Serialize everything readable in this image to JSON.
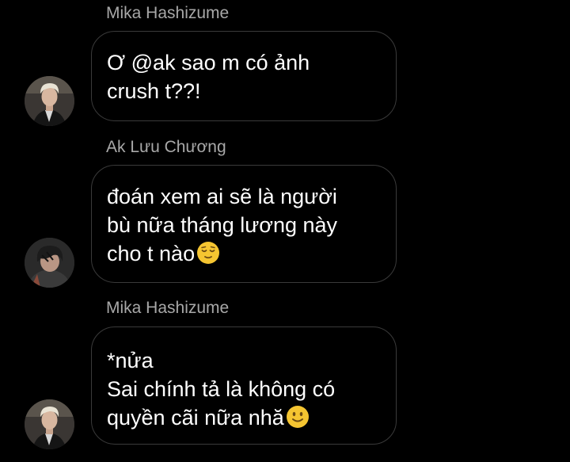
{
  "colors": {
    "background": "#000000",
    "sender_name": "#a8a8a8",
    "bubble_border": "#3a3a3a",
    "message_text": "#ffffff",
    "emoji_yellow": "#f5c531"
  },
  "messages": [
    {
      "sender": "Mika Hashizume",
      "text": "Ơ @ak sao m có ảnh\ncrush t??!",
      "emoji": "",
      "avatar_icon": "blonde-man-avatar-icon"
    },
    {
      "sender": "Ak Lưu Chương",
      "text": "đoán xem ai sẽ là người\nbù nữa tháng lương này\ncho t nào",
      "emoji": "relieved-face-emoji",
      "avatar_icon": "dark-hair-man-avatar-icon"
    },
    {
      "sender": "Mika Hashizume",
      "text": "*nửa\nSai chính tả là không có\nquyền cãi nữa nhă",
      "emoji": "slightly-smiling-face-emoji",
      "avatar_icon": "blonde-man-avatar-icon"
    }
  ]
}
